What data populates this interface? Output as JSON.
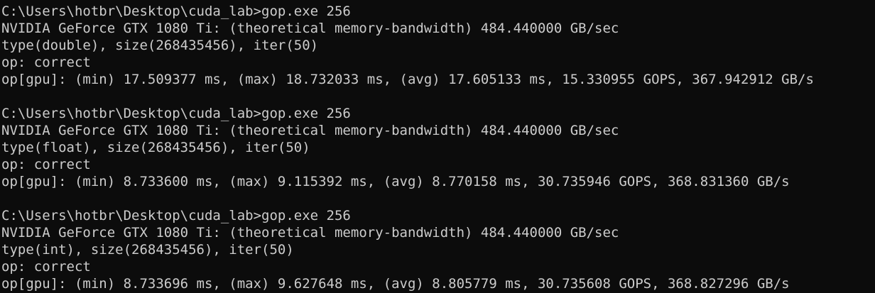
{
  "console": {
    "lines": [
      "C:\\Users\\hotbr\\Desktop\\cuda_lab>gop.exe 256",
      "NVIDIA GeForce GTX 1080 Ti: (theoretical memory-bandwidth) 484.440000 GB/sec",
      "type(double), size(268435456), iter(50)",
      "op: correct",
      "op[gpu]: (min) 17.509377 ms, (max) 18.732033 ms, (avg) 17.605133 ms, 15.330955 GOPS, 367.942912 GB/s",
      "",
      "C:\\Users\\hotbr\\Desktop\\cuda_lab>gop.exe 256",
      "NVIDIA GeForce GTX 1080 Ti: (theoretical memory-bandwidth) 484.440000 GB/sec",
      "type(float), size(268435456), iter(50)",
      "op: correct",
      "op[gpu]: (min) 8.733600 ms, (max) 9.115392 ms, (avg) 8.770158 ms, 30.735946 GOPS, 368.831360 GB/s",
      "",
      "C:\\Users\\hotbr\\Desktop\\cuda_lab>gop.exe 256",
      "NVIDIA GeForce GTX 1080 Ti: (theoretical memory-bandwidth) 484.440000 GB/sec",
      "type(int), size(268435456), iter(50)",
      "op: correct",
      "op[gpu]: (min) 8.733696 ms, (max) 9.627648 ms, (avg) 8.805779 ms, 30.735608 GOPS, 368.827296 GB/s"
    ]
  },
  "colors": {
    "background": "#0c0c0c",
    "text": "#cccccc"
  }
}
